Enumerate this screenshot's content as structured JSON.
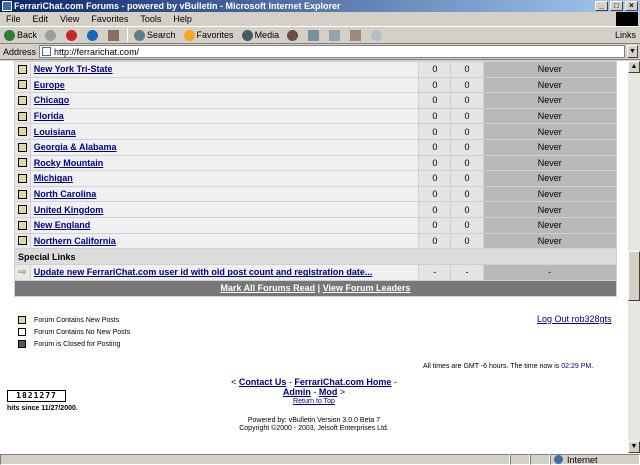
{
  "window": {
    "title": "FerrariChat.com Forums - powered by vBulletin - Microsoft Internet Explorer"
  },
  "menu": [
    "File",
    "Edit",
    "View",
    "Favorites",
    "Tools",
    "Help"
  ],
  "toolbar": {
    "back": "Back",
    "search": "Search",
    "favorites": "Favorites",
    "media": "Media",
    "links": "Links"
  },
  "address": {
    "label": "Address",
    "url": "http://ferrarichat.com/"
  },
  "forums": [
    {
      "name": "New York Tri-State",
      "posts": "0",
      "threads": "0",
      "last": "Never"
    },
    {
      "name": "Europe",
      "posts": "0",
      "threads": "0",
      "last": "Never"
    },
    {
      "name": "Chicago",
      "posts": "0",
      "threads": "0",
      "last": "Never"
    },
    {
      "name": "Florida",
      "posts": "0",
      "threads": "0",
      "last": "Never"
    },
    {
      "name": "Louisiana",
      "posts": "0",
      "threads": "0",
      "last": "Never"
    },
    {
      "name": "Georgia & Alabama",
      "posts": "0",
      "threads": "0",
      "last": "Never"
    },
    {
      "name": "Rocky Mountain",
      "posts": "0",
      "threads": "0",
      "last": "Never"
    },
    {
      "name": "Michigan",
      "posts": "0",
      "threads": "0",
      "last": "Never"
    },
    {
      "name": "North Carolina",
      "posts": "0",
      "threads": "0",
      "last": "Never"
    },
    {
      "name": "United Kingdom",
      "posts": "0",
      "threads": "0",
      "last": "Never"
    },
    {
      "name": "New England",
      "posts": "0",
      "threads": "0",
      "last": "Never"
    },
    {
      "name": "Northern California",
      "posts": "0",
      "threads": "0",
      "last": "Never"
    }
  ],
  "special": {
    "header": "Special Links",
    "link": "Update new FerrariChat.com user id with old post count and registration date...",
    "posts": "-",
    "threads": "-",
    "last": "-"
  },
  "footer_links": {
    "mark_read": "Mark All Forums Read",
    "separator": "|",
    "leaders": "View Forum Leaders"
  },
  "legend": [
    "Forum Contains New Posts",
    "Forum Contains No New Posts",
    "Forum is Closed for Posting"
  ],
  "logout": "Log Out rob328gts",
  "time": {
    "prefix": "All times are GMT -6 hours. The time now is",
    "value": "02:29 PM",
    "suffix": "."
  },
  "counter": {
    "value": "1821277",
    "hits": "hits since 11/27/2000."
  },
  "bottom": {
    "contact": "Contact Us",
    "home": "FerrariChat.com Home",
    "admin": "Admin",
    "mod": "Mod",
    "return_top": "Return to Top",
    "powered": "Powered by: vBulletin Version 3.0.0 Beta 7",
    "copyright": "Copyright ©2000 - 2003, Jelsoft Enterprises Ltd."
  },
  "status": {
    "zone": "Internet"
  }
}
